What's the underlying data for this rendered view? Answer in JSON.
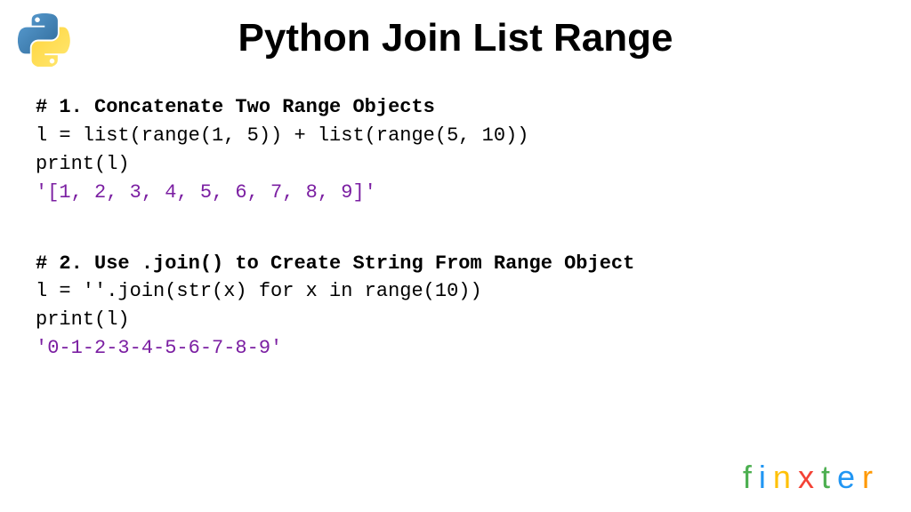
{
  "title": "Python Join List Range",
  "block1": {
    "comment": "# 1. Concatenate Two Range Objects",
    "line1": "l = list(range(1, 5)) + list(range(5, 10))",
    "line2": "print(l)",
    "output": "'[1, 2, 3, 4, 5, 6, 7, 8, 9]'"
  },
  "block2": {
    "comment": "# 2. Use .join() to Create String From Range Object",
    "line1": "l = ''.join(str(x) for x in range(10))",
    "line2": "print(l)",
    "output": "'0-1-2-3-4-5-6-7-8-9'"
  },
  "watermark": {
    "f": "f",
    "i": "i",
    "n": "n",
    "x": "x",
    "t": "t",
    "e": "e",
    "r": "r"
  }
}
